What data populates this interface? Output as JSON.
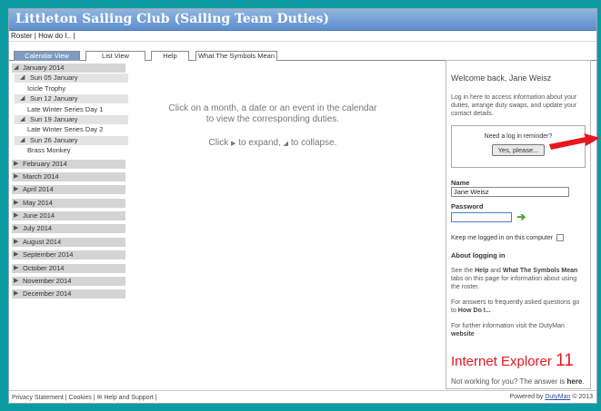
{
  "app": {
    "title": "Littleton Sailing Club (Sailing Team Duties)"
  },
  "menu": {
    "roster": "Roster",
    "sep": "|",
    "howdo": "How do I..",
    "sep2": "|"
  },
  "tabs": [
    {
      "label": "Calendar View",
      "active": true
    },
    {
      "label": "List View",
      "active": false
    },
    {
      "label": "Help",
      "active": false
    },
    {
      "label": "What The Symbols Mean",
      "active": false
    }
  ],
  "calendar": {
    "january": "January 2014",
    "d1": "Sun 05 January",
    "e1": "Icicle Trophy",
    "d2": "Sun 12 January",
    "e2": "Late Winter Series Day 1",
    "d3": "Sun 19 January",
    "e3": "Late Winter Series Day 2",
    "d4": "Sun 26 January",
    "e4": "Brass Monkey",
    "m2": "February 2014",
    "m3": "March 2014",
    "m4": "April 2014",
    "m5": "May 2014",
    "m6": "June 2014",
    "m7": "July 2014",
    "m8": "August 2014",
    "m9": "September 2014",
    "m10": "October 2014",
    "m11": "November 2014",
    "m12": "December 2014",
    "expanded_icon": "expanded-triangle-icon",
    "collapsed_icon": "collapsed-triangle-icon"
  },
  "center": {
    "line1": "Click on a month, a date or an event in the calendar",
    "line2": "to view the corresponding duties.",
    "click": "Click",
    "expand": "to expand,",
    "collapse": "to collapse."
  },
  "login": {
    "welcome": "Welcome back, Jane Weisz",
    "info": "Log in here to access information about your duties, arrange duty swaps, and update your contact details.",
    "reminder_q": "Need a log in reminder?",
    "reminder_btn": "Yes, please...",
    "name_label": "Name",
    "name_value": "Jane Weisz",
    "password_label": "Password",
    "keep": "Keep me logged in on this computer",
    "about": "About logging in",
    "help1_a": "See the",
    "help1_b": "Help",
    "help1_c": "and",
    "help1_d": "What The Symbols Mean",
    "help1_e": "tabs on this page for information about using the roster.",
    "faq_a": "For answers to frequently asked questions go to",
    "faq_b": "How Do I...",
    "web_a": "For further information visit the DutyMan",
    "web_b": "website",
    "ie": "Internet Explorer",
    "ie_num": "11",
    "notworking_a": "Not working for you? The answer is",
    "notworking_b": "here",
    "notworking_c": "."
  },
  "footer": {
    "left": "Privacy Statement | Cookies | ✉ Help and Support |",
    "powered": "Powered by",
    "brand": "DutyMan",
    "copy": "© 2013"
  },
  "colors": {
    "background": "#0d9ba3",
    "titlebar": "#6f9bd6",
    "active_tab": "#7f9cc0",
    "ie_red": "#e8171f",
    "go_green": "#47a32f"
  }
}
